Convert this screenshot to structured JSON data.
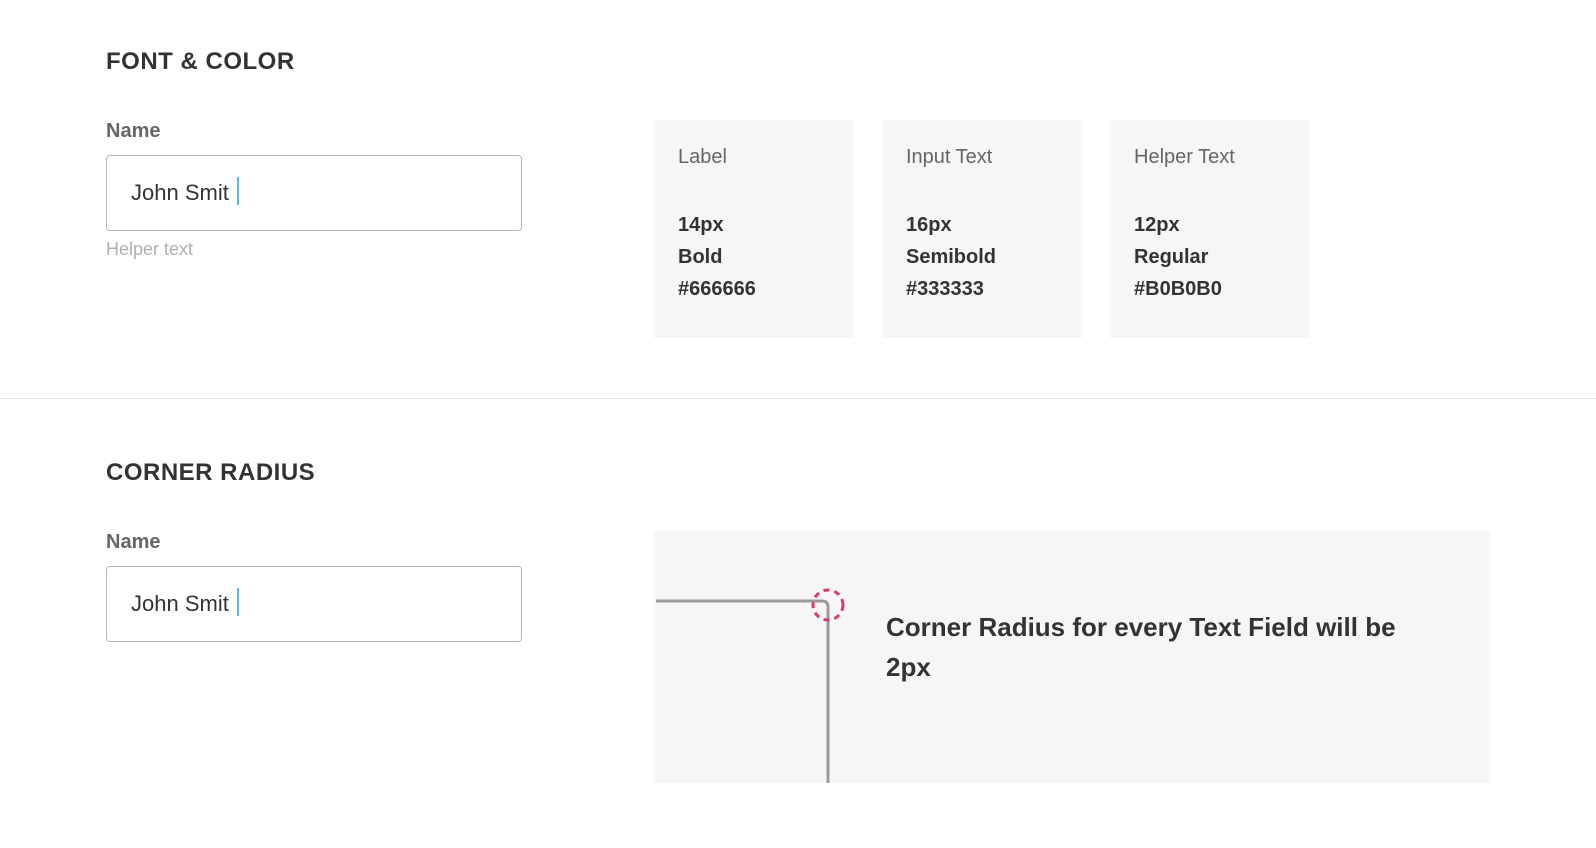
{
  "section1": {
    "title": "FONT & COLOR",
    "field": {
      "label": "Name",
      "value": "John Smit ",
      "helper": "Helper text"
    },
    "cards": [
      {
        "title": "Label",
        "size": "14px",
        "weight": "Bold",
        "color": "#666666"
      },
      {
        "title": "Input Text",
        "size": "16px",
        "weight": "Semibold",
        "color": "#333333"
      },
      {
        "title": "Helper Text",
        "size": "12px",
        "weight": "Regular",
        "color": "#B0B0B0"
      }
    ]
  },
  "section2": {
    "title": "CORNER RADIUS",
    "field": {
      "label": "Name",
      "value": "John Smit "
    },
    "note": "Corner Radius for every Text Field will be 2px"
  }
}
